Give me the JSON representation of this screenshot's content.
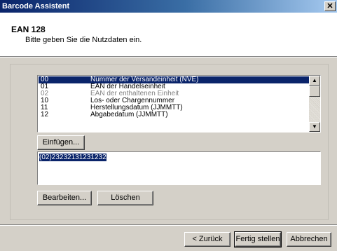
{
  "window": {
    "title": "Barcode Assistent",
    "close_label": "✕"
  },
  "header": {
    "title": "EAN 128",
    "subtitle": "Bitte geben Sie die Nutzdaten ein."
  },
  "list": {
    "items": [
      {
        "code": "00",
        "label": "Nummer der Versandeinheit (NVE)",
        "selected": true,
        "disabled": false
      },
      {
        "code": "01",
        "label": "EAN der Handelseinheit",
        "selected": false,
        "disabled": false
      },
      {
        "code": "02",
        "label": "EAN der enthaltenen Einheit",
        "selected": false,
        "disabled": true
      },
      {
        "code": "10",
        "label": "Los- oder Chargennummer",
        "selected": false,
        "disabled": false
      },
      {
        "code": "11",
        "label": "Herstellungsdatum (JJMMTT)",
        "selected": false,
        "disabled": false
      },
      {
        "code": "12",
        "label": "Abgabedatum (JJMMTT)",
        "selected": false,
        "disabled": false
      }
    ],
    "scroll_up": "▲",
    "scroll_down": "▼"
  },
  "buttons": {
    "insert": "Einfügen...",
    "edit": "Bearbeiten...",
    "delete": "Löschen",
    "back": "< Zurück",
    "finish": "Fertig stellen",
    "cancel": "Abbrechen"
  },
  "data_field": {
    "value": "(02)23232131231232"
  },
  "colors": {
    "titlebar_start": "#0a246a",
    "selection": "#0a246a",
    "face": "#d4d0c8"
  }
}
